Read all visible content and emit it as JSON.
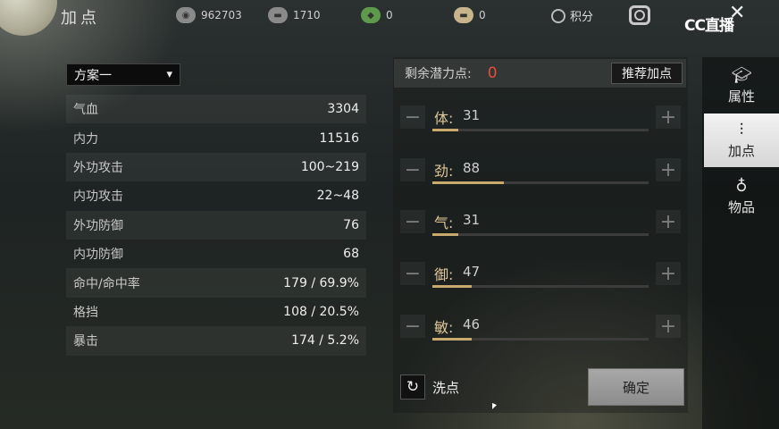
{
  "header": {
    "title": "加点",
    "resources": [
      {
        "icon": "film-icon",
        "value": "962703"
      },
      {
        "icon": "ingot-icon",
        "value": "1710"
      },
      {
        "icon": "jade-icon",
        "value": "0"
      },
      {
        "icon": "gold-ingot-icon",
        "value": "0"
      }
    ],
    "score_label": "积分",
    "watermark": "CC直播"
  },
  "left": {
    "plan_label": "方案一",
    "stats": [
      {
        "label": "气血",
        "value": "3304"
      },
      {
        "label": "内力",
        "value": "11516"
      },
      {
        "label": "外功攻击",
        "value": "100~219"
      },
      {
        "label": "内功攻击",
        "value": "22~48"
      },
      {
        "label": "外功防御",
        "value": "76"
      },
      {
        "label": "内功防御",
        "value": "68"
      },
      {
        "label": "命中/命中率",
        "value": "179 / 69.9%"
      },
      {
        "label": "格挡",
        "value": "108 / 20.5%"
      },
      {
        "label": "暴击",
        "value": "174 / 5.2%"
      }
    ]
  },
  "allocation": {
    "remaining_label": "剩余潜力点:",
    "remaining_value": "0",
    "recommend_label": "推荐加点",
    "attributes": [
      {
        "name": "体:",
        "value": "31",
        "fill": 0.12
      },
      {
        "name": "劲:",
        "value": "88",
        "fill": 0.33
      },
      {
        "name": "气:",
        "value": "31",
        "fill": 0.12
      },
      {
        "name": "御:",
        "value": "47",
        "fill": 0.18
      },
      {
        "name": "敏:",
        "value": "46",
        "fill": 0.18
      }
    ],
    "minus_symbol": "−",
    "plus_symbol": "+",
    "reset_label": "洗点",
    "confirm_label": "确定"
  },
  "tabs": [
    {
      "label": "属性",
      "icon": "graduation-cap-icon",
      "active": false
    },
    {
      "label": "加点",
      "icon": "sliders-icon",
      "active": true
    },
    {
      "label": "物品",
      "icon": "pouch-icon",
      "active": false
    }
  ]
}
